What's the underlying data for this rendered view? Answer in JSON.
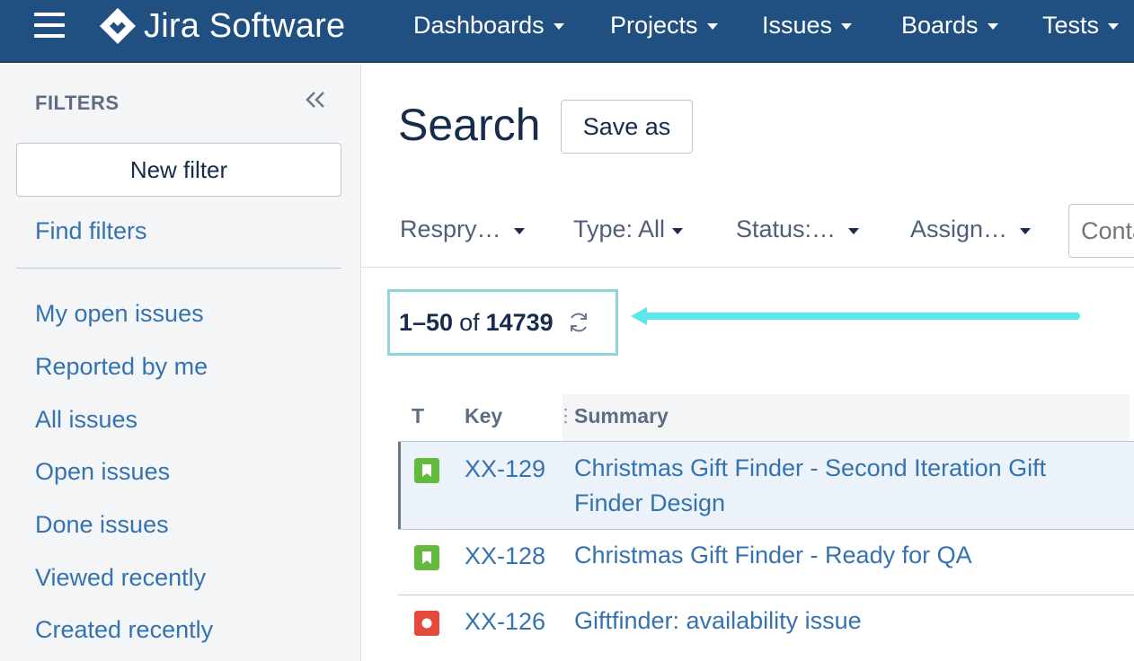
{
  "app": {
    "name": "Jira Software"
  },
  "nav": {
    "items": [
      {
        "label": "Dashboards"
      },
      {
        "label": "Projects"
      },
      {
        "label": "Issues"
      },
      {
        "label": "Boards"
      },
      {
        "label": "Tests"
      }
    ]
  },
  "sidebar": {
    "title": "FILTERS",
    "new_filter": "New filter",
    "find_filters": "Find filters",
    "links": [
      {
        "label": "My open issues"
      },
      {
        "label": "Reported by me"
      },
      {
        "label": "All issues"
      },
      {
        "label": "Open issues"
      },
      {
        "label": "Done issues"
      },
      {
        "label": "Viewed recently"
      },
      {
        "label": "Created recently"
      }
    ]
  },
  "main": {
    "title": "Search",
    "save_as": "Save as",
    "filters": [
      {
        "label": "Respry…"
      },
      {
        "label": "Type: All"
      },
      {
        "label": "Status:…"
      },
      {
        "label": "Assign…"
      }
    ],
    "contains_placeholder": "Contains text"
  },
  "results": {
    "range": "1–50",
    "of": "of",
    "total": "14739"
  },
  "table": {
    "columns": {
      "type": "T",
      "key": "Key",
      "summary": "Summary"
    },
    "rows": [
      {
        "type": "story",
        "type_color": "#63ba3c",
        "key": "XX-129",
        "summary": "Christmas Gift Finder - Second Iteration Gift Finder Design",
        "selected": true
      },
      {
        "type": "story",
        "type_color": "#63ba3c",
        "key": "XX-128",
        "summary": "Christmas Gift Finder - Ready for QA",
        "selected": false
      },
      {
        "type": "bug",
        "type_color": "#e5493a",
        "key": "XX-126",
        "summary": "Giftfinder: availability issue",
        "selected": false
      }
    ]
  },
  "colors": {
    "header_bg": "#205081",
    "link": "#3572b0",
    "highlight_annotation": "#5ce6e8"
  }
}
